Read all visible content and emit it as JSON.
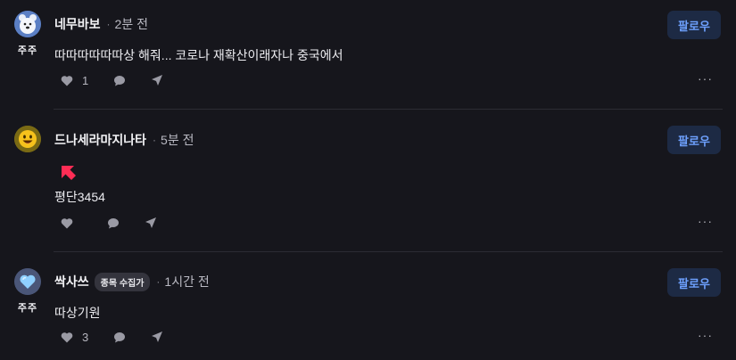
{
  "posts": [
    {
      "author": "네무바보",
      "time": "2분 전",
      "role": "주주",
      "badge": "",
      "text": "따따따따따따상 해줘... 코로나 재확산이래자나 중국에서",
      "likes": "1",
      "follow_label": "팔로우",
      "avatar_icon": "bear-mascot-icon"
    },
    {
      "author": "드나세라마지나타",
      "time": "5분 전",
      "role": "",
      "badge": "",
      "text": "평단3454",
      "likes": "",
      "follow_label": "팔로우",
      "avatar_icon": "smiley-face-icon",
      "sticker_icon": "red-arrow-icon"
    },
    {
      "author": "싹사쓰",
      "time": "1시간 전",
      "role": "주주",
      "badge": "종목 수집가",
      "text": "따상기원",
      "likes": "3",
      "follow_label": "팔로우",
      "avatar_icon": "blue-heart-icon"
    }
  ],
  "more_label": "···",
  "colors": {
    "background": "#16161c",
    "follow_bg": "#1d2a44",
    "follow_text": "#6ea1ff",
    "arrow": "#ff2d55"
  }
}
